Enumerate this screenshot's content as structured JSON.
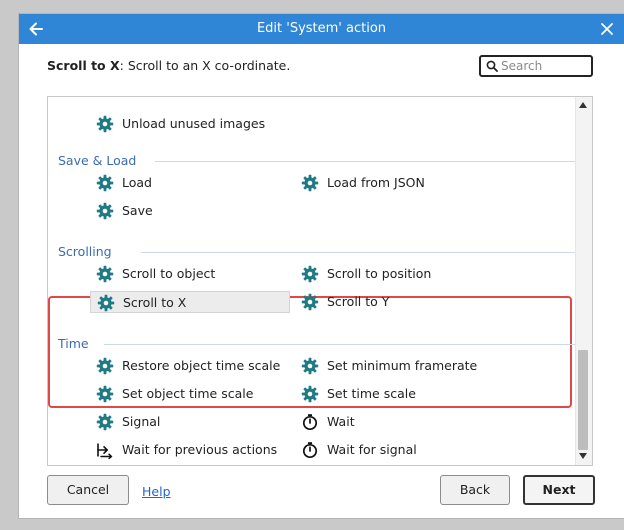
{
  "window": {
    "title": "Edit 'System' action"
  },
  "header": {
    "action_name": "Scroll to X",
    "action_desc": ": Scroll to an X co-ordinate."
  },
  "search": {
    "placeholder": "Search"
  },
  "list": {
    "top_item": {
      "label": "Unload unused images",
      "icon": "gear-icon"
    },
    "categories": [
      {
        "name": "Save & Load",
        "items": [
          {
            "label": "Load",
            "icon": "gear-icon"
          },
          {
            "label": "Load from JSON",
            "icon": "gear-icon"
          },
          {
            "label": "Save",
            "icon": "gear-icon"
          }
        ]
      },
      {
        "name": "Scrolling",
        "items": [
          {
            "label": "Scroll to object",
            "icon": "gear-icon"
          },
          {
            "label": "Scroll to position",
            "icon": "gear-icon"
          },
          {
            "label": "Scroll to X",
            "icon": "gear-icon",
            "selected": true
          },
          {
            "label": "Scroll to Y",
            "icon": "gear-icon"
          }
        ]
      },
      {
        "name": "Time",
        "items": [
          {
            "label": "Restore object time scale",
            "icon": "gear-icon"
          },
          {
            "label": "Set minimum framerate",
            "icon": "gear-icon"
          },
          {
            "label": "Set object time scale",
            "icon": "gear-icon"
          },
          {
            "label": "Set time scale",
            "icon": "gear-icon"
          },
          {
            "label": "Signal",
            "icon": "gear-icon"
          },
          {
            "label": "Wait",
            "icon": "stopwatch-icon"
          },
          {
            "label": "Wait for previous actions",
            "icon": "wait-previous-icon"
          },
          {
            "label": "Wait for signal",
            "icon": "stopwatch-icon"
          }
        ]
      }
    ]
  },
  "footer": {
    "cancel_label": "Cancel",
    "help_label": "Help",
    "back_label": "Back",
    "next_label": "Next"
  },
  "colors": {
    "titlebar": "#2f86d6",
    "gear_icon": "#1f7a86",
    "category_text": "#3b6bb3",
    "highlight_border": "#e04848"
  }
}
